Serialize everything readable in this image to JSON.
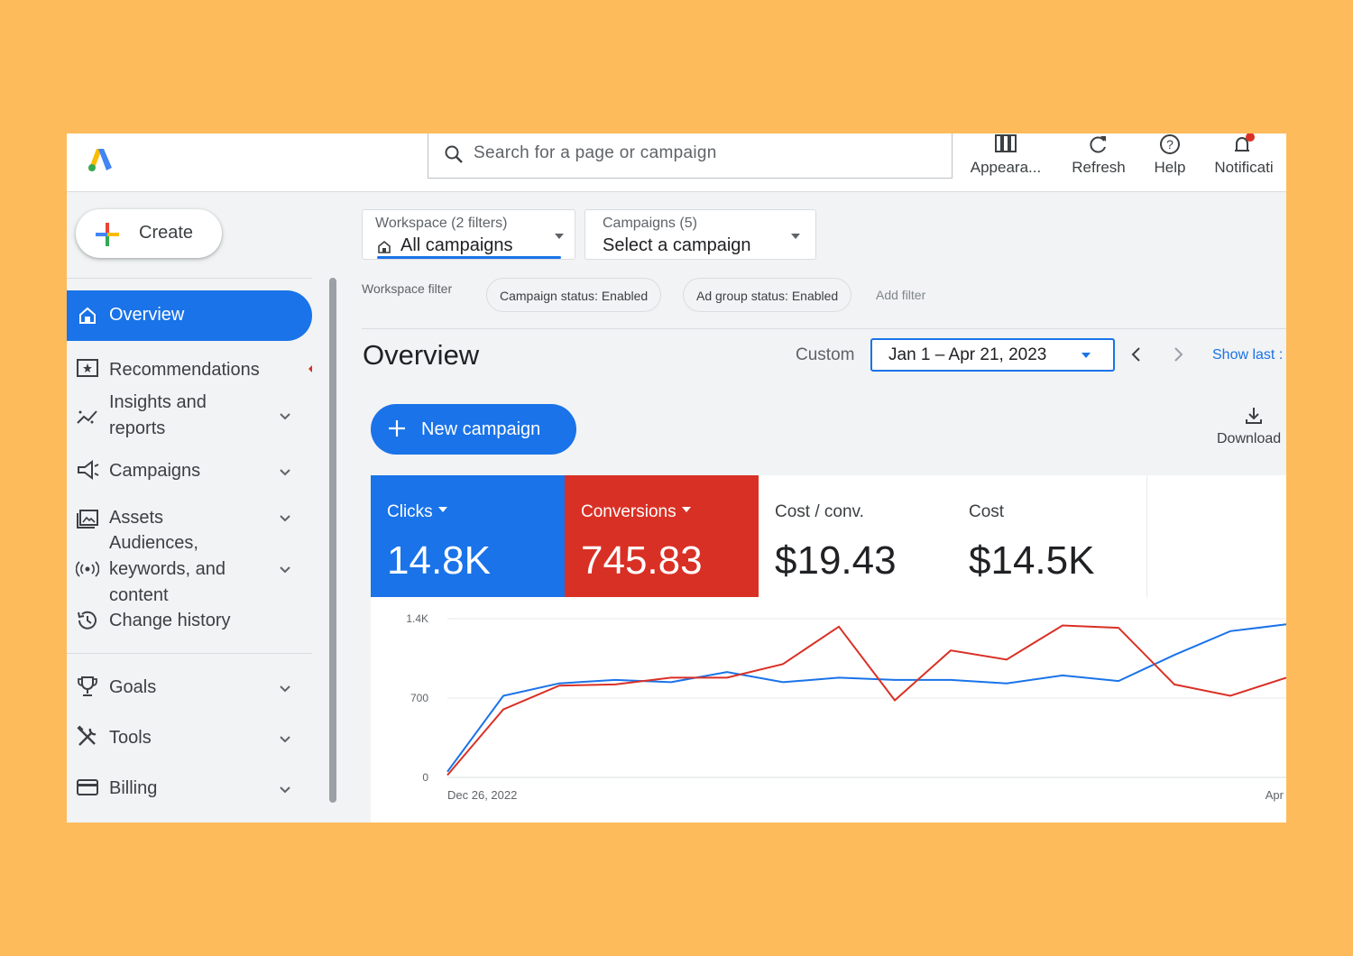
{
  "colors": {
    "background": "#FDBB5C",
    "accent": "#1a73e8",
    "conversions": "#d93025"
  },
  "topbar": {
    "logo_icon": "google-ads-logo",
    "search_placeholder": "Search for a page or campaign",
    "buttons": [
      {
        "label": "Appeara...",
        "icon": "appearance-icon"
      },
      {
        "label": "Refresh",
        "icon": "refresh-icon"
      },
      {
        "label": "Help",
        "icon": "help-icon"
      },
      {
        "label": "Notificati",
        "icon": "bell-icon"
      }
    ]
  },
  "sidebar": {
    "create_label": "Create",
    "items": [
      {
        "label": "Overview",
        "icon": "home-icon",
        "active": true
      },
      {
        "label": "Recommendations",
        "icon": "recommendations-icon"
      },
      {
        "label": "Insights and",
        "label2": "reports",
        "icon": "insights-icon"
      },
      {
        "label": "Campaigns",
        "icon": "megaphone-icon"
      },
      {
        "label": "Assets",
        "icon": "assets-icon"
      },
      {
        "label": "Audiences,",
        "label2": "keywords, and",
        "label3": "content",
        "icon": "audiences-icon"
      },
      {
        "label": "Change history",
        "icon": "history-icon"
      },
      {
        "label": "Goals",
        "icon": "trophy-icon"
      },
      {
        "label": "Tools",
        "icon": "tools-icon"
      },
      {
        "label": "Billing",
        "icon": "billing-icon"
      }
    ]
  },
  "filters": {
    "workspace_label": "Workspace (2 filters)",
    "workspace_value": "All campaigns",
    "campaigns_label": "Campaigns (5)",
    "campaigns_value": "Select a campaign",
    "workspace_filter_label": "Workspace filter",
    "chips": [
      "Campaign status: Enabled",
      "Ad group status: Enabled"
    ],
    "add_filter": "Add filter"
  },
  "overview": {
    "title": "Overview",
    "range_type": "Custom",
    "date_range": "Jan 1 – Apr 21, 2023",
    "show_last": "Show last :",
    "new_campaign": "New campaign",
    "download": "Download"
  },
  "metrics": [
    {
      "title": "Clicks",
      "value": "14.8K",
      "selected": true,
      "color": "#1a73e8"
    },
    {
      "title": "Conversions",
      "value": "745.83",
      "selected": true,
      "color": "#d93025"
    },
    {
      "title": "Cost / conv.",
      "value": "$19.43",
      "selected": false
    },
    {
      "title": "Cost",
      "value": "$14.5K",
      "selected": false
    }
  ],
  "chart_data": {
    "type": "line",
    "x_labels": [
      "Dec 26, 2022",
      "Apr"
    ],
    "y_ticks": [
      "1.4K",
      "700",
      "0"
    ],
    "ylim": [
      0,
      1400
    ],
    "grid": true,
    "series": [
      {
        "color": "#1a73e8",
        "values": [
          50,
          720,
          830,
          860,
          840,
          930,
          840,
          880,
          860,
          860,
          830,
          900,
          850,
          1080,
          1290,
          1350
        ]
      },
      {
        "color": "#d93025",
        "values": [
          20,
          600,
          810,
          820,
          880,
          880,
          1000,
          1330,
          680,
          1120,
          1040,
          1340,
          1320,
          820,
          720,
          880
        ]
      }
    ]
  }
}
